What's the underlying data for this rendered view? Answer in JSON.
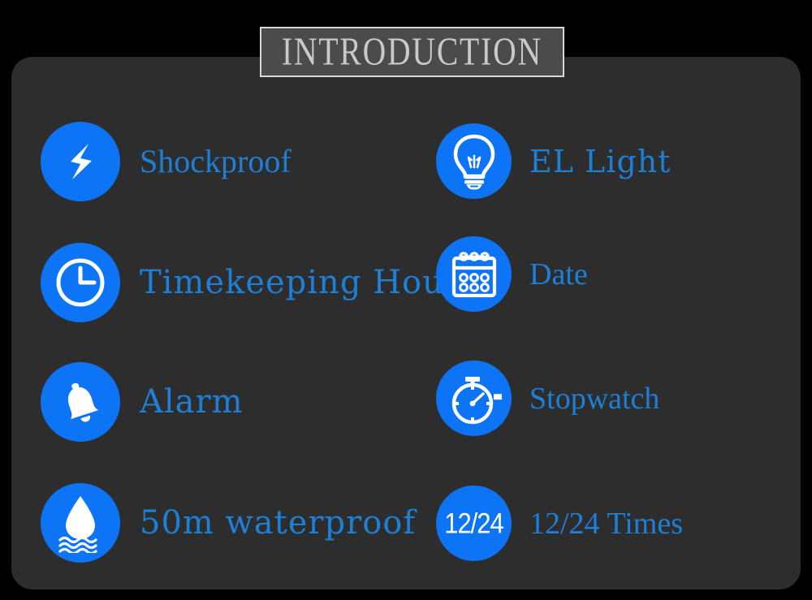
{
  "header": {
    "title": "INTRODUCTION"
  },
  "colors": {
    "page_background": "#000000",
    "panel_background": "#2d2d2d",
    "title_plate_background": "#4b4b4b",
    "title_plate_border": "#d8d8d8",
    "title_text": "#c9c9c9",
    "icon_circle_blue": "#0d74f5",
    "icon_glyph_white": "#ffffff",
    "label_blue": "#1d7fd6"
  },
  "features": {
    "left_column": [
      {
        "id": "shockproof",
        "label": "Shockproof",
        "icon": "lightning-bolt-icon"
      },
      {
        "id": "timekeeping-hour",
        "label": "Timekeeping Hour",
        "icon": "clock-icon"
      },
      {
        "id": "alarm",
        "label": "Alarm",
        "icon": "bell-icon"
      },
      {
        "id": "waterproof",
        "label": "50m waterproof",
        "icon": "water-drop-icon"
      }
    ],
    "right_column": [
      {
        "id": "el-light",
        "label": "EL Light",
        "icon": "lightbulb-icon"
      },
      {
        "id": "date",
        "label": "Date",
        "icon": "calendar-icon"
      },
      {
        "id": "stopwatch",
        "label": "Stopwatch",
        "icon": "stopwatch-icon"
      },
      {
        "id": "twelve-twentyfour-times",
        "label": "12/24 Times",
        "icon": "twelve-twentyfour-icon",
        "icon_text": "12/24"
      }
    ]
  }
}
